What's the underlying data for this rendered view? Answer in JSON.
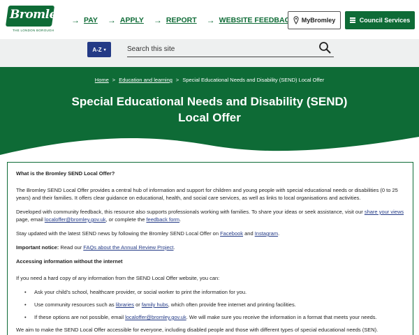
{
  "header": {
    "logo_text": "Bromley",
    "logo_sub": "THE LONDON BOROUGH",
    "links": [
      {
        "arrow": "→",
        "label": "PAY"
      },
      {
        "arrow": "→",
        "label": "APPLY"
      },
      {
        "arrow": "→",
        "label": "REPORT"
      },
      {
        "arrow": "→",
        "label": "WEBSITE FEEDBACK"
      }
    ],
    "mybromley_label": "MyBromley",
    "council_label": "Council Services"
  },
  "search": {
    "az_label": "A-Z",
    "az_caret": "▾",
    "placeholder": "Search this site"
  },
  "hero": {
    "breadcrumb": [
      "Home",
      "Education and learning",
      "Special Educational Needs and Disability (SEND) Local Offer"
    ],
    "breadcrumb_sep": ">",
    "title": "Special Educational Needs and Disability (SEND) Local Offer"
  },
  "content": {
    "heading1": "What is the Bromley SEND Local Offer?",
    "p1": "The Bromley SEND Local Offer provides a central hub of information and support for children and young people with special educational needs or disabilities (0 to 25 years) and their families. It offers clear guidance on educational, health, and social care services, as well as links to local organisations and activities.",
    "p2_a": "Developed with community feedback, this resource also supports professionals working with families. To share your ideas or seek assistance, visit our ",
    "p2_link1": "share your views",
    "p2_b": " page, email ",
    "p2_link2": "localoffer@bromley.gov.uk",
    "p2_c": ", or complete the ",
    "p2_link3": "feedback form",
    "p2_d": ".",
    "p3_a": "Stay updated with the latest SEND news by following the Bromley SEND Local Offer on ",
    "p3_link1": "Facebook",
    "p3_b": " and ",
    "p3_link2": "Instagram",
    "p3_c": ".",
    "notice_label": "Important notice:",
    "notice_a": " Read our ",
    "notice_link": "FAQs about the Annual Review Project",
    "notice_b": ".",
    "heading2": "Accessing information without the internet",
    "p4": "If you need a hard copy of any information from the SEND Local Offer website, you can:",
    "li1": "Ask your child's school, healthcare provider, or social worker to print the information for you.",
    "li2_a": "Use community resources such as ",
    "li2_link1": "libraries",
    "li2_b": " or ",
    "li2_link2": "family hubs",
    "li2_c": ", which often provide free internet and printing facilities.",
    "li3_a": "If these options are not possible, email ",
    "li3_link": "localoffer@bromley.gov.uk",
    "li3_b": ". We will make sure you receive the information in a format that meets your needs.",
    "p5": "We aim to make the SEND Local Offer accessible for everyone, including disabled people and those with different types of special educational needs (SEN)."
  },
  "colors": {
    "brand_green": "#0e6b36",
    "az_blue": "#233a86",
    "search_bg": "#eef0f0"
  }
}
